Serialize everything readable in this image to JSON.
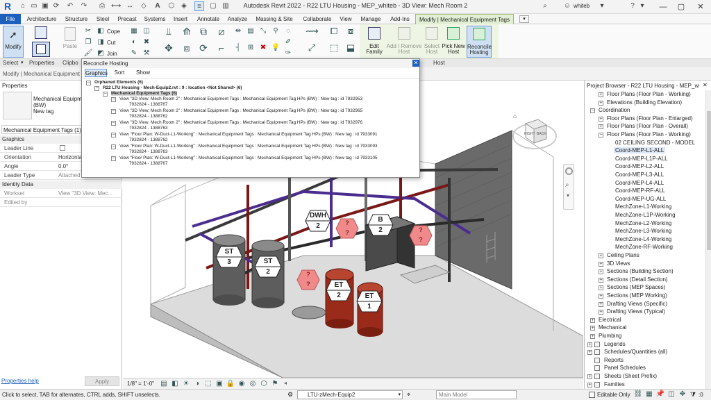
{
  "app": {
    "title": "Autodesk Revit 2022 - R22 LTU Housing - MEP_whiteb - 3D View: Mech Room 2",
    "user": "whiteb",
    "logo": "R"
  },
  "tabs": [
    "File",
    "Architecture",
    "Structure",
    "Steel",
    "Precast",
    "Systems",
    "Insert",
    "Annotate",
    "Analyze",
    "Massing & Site",
    "Collaborate",
    "View",
    "Manage",
    "Add-Ins",
    "Modify | Mechanical Equipment Tags"
  ],
  "ribbon": {
    "modify_label": "Modify",
    "paste_label": "Paste",
    "cope_label": "Cope",
    "cut_label": "Cut",
    "join_label": "Join",
    "edit_family_label": "Edit Family",
    "add_remove_host_label": "Add / Remove Host",
    "select_host_label": "Select Host",
    "pick_new_host_label": "Pick New Host",
    "reconcile_hosting_label": "Reconcile Hosting"
  },
  "panels": {
    "select": "Select",
    "properties": "Properties",
    "clipboard": "Clipbo",
    "host": "Host"
  },
  "options_bar": {
    "context_label": "Modify | Mechanical Equipment"
  },
  "properties": {
    "header": "Properties",
    "type_line1": "Mechanical Equipm",
    "type_line2": "(BW)",
    "type_line3": "New tag",
    "category": "Mechanical Equipment Tags (1)",
    "graphics_section": "Graphics",
    "rows": [
      {
        "key": "Leader Line",
        "value": ""
      },
      {
        "key": "Orientation",
        "value": "Horizonta"
      },
      {
        "key": "Angle",
        "value": "0.0°"
      },
      {
        "key": "Leader Type",
        "value": "Attached"
      }
    ],
    "identity_section": "Identity Data",
    "identity_rows": [
      {
        "key": "Workset",
        "value": "View \"3D View: Mec..."
      },
      {
        "key": "Edited by",
        "value": ""
      }
    ],
    "help_link": "Properties help",
    "apply_label": "Apply"
  },
  "dialog": {
    "title": "Reconcile Hosting",
    "tabs": [
      "Graphics",
      "Sort",
      "Show"
    ],
    "lines": [
      "Orphaned Elements (6)",
      "R22 LTU Housing - Mech-Equip2.rvt : 9 : location <Not Shared> (6)",
      "Mechanical Equipment Tags (6)",
      "View \"3D View: Mech Room 2\" : Mechanical Equipment Tags : Mechanical Equipment Tag HPs (BW) : New tag : id 7932953",
      "7932824 - 1388767",
      "View \"3D View: Mech Room 2\" : Mechanical Equipment Tags : Mechanical Equipment Tag HPs (BW) : New tag : id 7932965",
      "7932824 - 1388762",
      "View \"3D View: Mech Room 2\" : Mechanical Equipment Tags : Mechanical Equipment Tag HPs (BW) : New tag : id 7932976",
      "7932824 - 1388763",
      "View \"Floor Plan: W-Duct-L1-Working\" : Mechanical Equipment Tags : Mechanical Equipment Tag HPs (BW) : New tag : id 7933091",
      "7932824 - 1388762",
      "View \"Floor Plan: W-Duct-L1-Working\" : Mechanical Equipment Tags : Mechanical Equipment Tag HPs (BW) : New tag : id 7933093",
      "7932824 - 1388763",
      "View \"Floor Plan: W-Duct-L1-Working\" : Mechanical Equipment Tags : Mechanical Equipment Tag HPs (BW) : New tag : id 7933105",
      "7932824 - 1388767"
    ]
  },
  "viewcube": {
    "right": "RIGHT",
    "back": "BACK"
  },
  "tags": [
    {
      "label": "DWH",
      "num": "2"
    },
    {
      "label": "B",
      "num": "2"
    },
    {
      "label": "ST",
      "num": "3"
    },
    {
      "label": "ST",
      "num": "2"
    },
    {
      "label": "ET",
      "num": "2"
    },
    {
      "label": "ET",
      "num": "1"
    },
    {
      "label": "?",
      "num": "?"
    },
    {
      "label": "?",
      "num": "?"
    },
    {
      "label": "?",
      "num": "?"
    }
  ],
  "view_bar": {
    "scale": "1/8\" = 1'-0\""
  },
  "browser": {
    "header": "Project Browser - R22 LTU Housing - MEP_whiteb",
    "items": [
      "Floor Plans (Floor Plan - Working)",
      "Elevations (Building Elevation)",
      "Coordination",
      "Floor Plans (Floor Plan - Enlarged)",
      "Floor Plans (Floor Plan - Overall)",
      "Floor Plans (Floor Plan - Working)",
      "02 CEILING SECOND - MODEL",
      "Coord-MEP-L1-ALL",
      "Coord-MEP-L1P-ALL",
      "Coord-MEP-L2-ALL",
      "Coord-MEP-L3-ALL",
      "Coord-MEP-L4-ALL",
      "Coord-MEP-RF-ALL",
      "Coord-MEP-UG-ALL",
      "MechZone-L1-Working",
      "MechZone-L1P-Working",
      "MechZone-L2-Working",
      "MechZone-L3-Working",
      "MechZone-L4-Working",
      "MechZone-RF-Working",
      "Ceiling Plans",
      "3D Views",
      "Sections (Building Section)",
      "Sections (Detail Section)",
      "Sections (MEP Spaces)",
      "Sections (MEP Working)",
      "Drafting Views (Specific)",
      "Drafting Views (Typical)",
      "Electrical",
      "Mechanical",
      "Plumbing",
      "Legends",
      "Schedules/Quantities (all)",
      "Reports",
      "Panel Schedules",
      "Sheets (Sheet Prefix)",
      "Families"
    ]
  },
  "status": {
    "message": "Click to select, TAB for alternates, CTRL adds, SHIFT unselects.",
    "workset": "LTU-zMech-Equip2",
    "design_option": "Main Model",
    "editable_only": "Editable Only",
    "filter_count": ":0"
  },
  "colors": {
    "accent": "#1b5fbf",
    "context_tab": "#e3efd4",
    "unhosted_tag": "#f08a8a",
    "pipe_red": "#8a2020",
    "pipe_purple": "#5a3aa0"
  }
}
